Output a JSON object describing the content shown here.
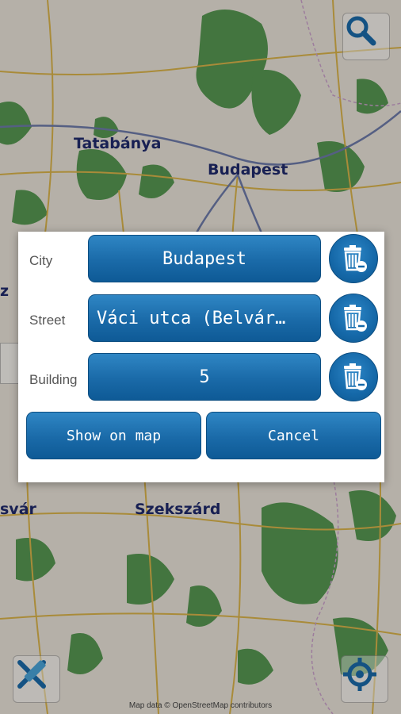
{
  "map": {
    "labels": {
      "tatabanya": "Tatabánya",
      "budapest": "Budapest",
      "szekszard": "Szekszárd",
      "left_vasar": "svár",
      "left_cut": "z"
    },
    "attribution": "Map data © OpenStreetMap contributors",
    "icons": {
      "search": "search-icon",
      "clear": "pencil-cross-icon",
      "locate": "crosshair-icon"
    }
  },
  "dialog": {
    "city": {
      "label": "City",
      "value": "Budapest"
    },
    "street": {
      "label": "Street",
      "value": "Váci utca (Belvár…"
    },
    "building": {
      "label": "Building",
      "value": "5"
    },
    "show_on_map": "Show on map",
    "cancel": "Cancel",
    "trash_icon": "trash-icon"
  },
  "colors": {
    "button_blue": "#1a6aa8",
    "label_gray": "#555555",
    "city_label": "#1f2a6b",
    "forest_green": "#2f7a2f"
  }
}
